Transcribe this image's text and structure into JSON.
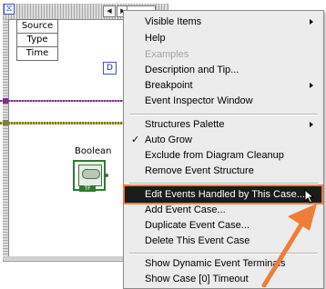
{
  "diagram": {
    "event_source_node": {
      "items": [
        "Source",
        "Type",
        "Time"
      ]
    },
    "case_selector_text": "D",
    "boolean_label": "Boolean",
    "boolean_terminal_tag": "TF"
  },
  "context_menu": {
    "items": [
      {
        "label": "Visible Items",
        "submenu": true
      },
      {
        "label": "Help"
      },
      {
        "label": "Examples",
        "disabled": true
      },
      {
        "label": "Description and Tip..."
      },
      {
        "label": "Breakpoint",
        "submenu": true
      },
      {
        "label": "Event Inspector Window"
      },
      {
        "label": "Structures Palette",
        "submenu": true
      },
      {
        "label": "Auto Grow",
        "checked": true
      },
      {
        "label": "Exclude from Diagram Cleanup"
      },
      {
        "label": "Remove Event Structure"
      },
      {
        "label": "Edit Events Handled by This Case...",
        "selected": true
      },
      {
        "label": "Add Event Case..."
      },
      {
        "label": "Duplicate Event Case..."
      },
      {
        "label": "Delete This Event Case"
      },
      {
        "label": "Show Dynamic Event Terminals"
      },
      {
        "label": "Show Case [0] Timeout"
      }
    ],
    "check_glyph": "✓"
  },
  "colors": {
    "menu_background": "#ececec",
    "highlight_background": "#1b1b1b",
    "highlight_outline": "#f07d3a",
    "annotation_arrow": "#f07d3a",
    "boolean_terminal": "#2f7a2f",
    "purple_wire": "#7c2f8c",
    "yellow_wire": "#808040"
  }
}
